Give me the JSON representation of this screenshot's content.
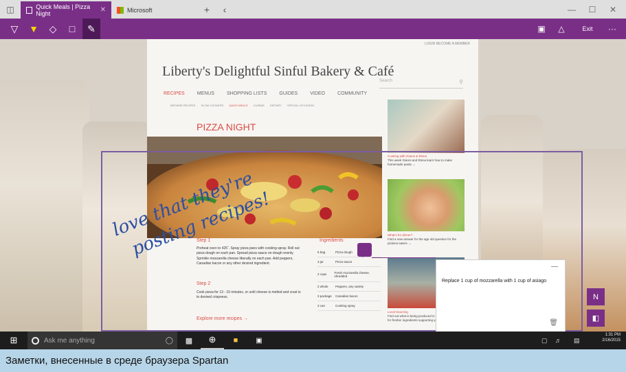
{
  "browser": {
    "tabs": [
      {
        "label": "Quick Meals | Pizza Night",
        "active": true
      },
      {
        "label": "Microsoft",
        "active": false
      }
    ],
    "toolbar": {
      "exit_label": "Exit",
      "more_label": "···"
    }
  },
  "page": {
    "top_links": "LOGIN  BECOME A MEMBER",
    "title": "Liberty's Delightful Sinful Bakery & Café",
    "search_placeholder": "Search",
    "nav": [
      "RECIPES",
      "MENUS",
      "SHOPPING LISTS",
      "GUIDES",
      "VIDEO",
      "COMMUNITY"
    ],
    "subnav": [
      "BROWSE RECIPES",
      "SLOW COOKERS",
      "QUICK MEALS",
      "CUISINE",
      "DIETARY",
      "SPECIAL OCCASION"
    ],
    "heading": "PIZZA NIGHT",
    "step1_title": "Step 1",
    "step1_text": "Preheat oven to 425˚. Spray pizza pans with cooking spray. Roll out pizza dough on each pan. Spread pizza sauce on dough evenly. Sprinkle mozzarella cheese liberally on each pan. Add peppers, Canadian bacon or any other desired ingredient.",
    "step2_title": "Step 2",
    "step2_text": "Cook pizza for 13 - 15 minutes, or until cheese is melted and crust is to desired crispness.",
    "more_link": "Explore more recipes →",
    "ingredients_title": "Ingredients",
    "ingredients": [
      {
        "qty": "5 bag",
        "item": "Pizza dough"
      },
      {
        "qty": "3 jar",
        "item": "Pizza sauce"
      },
      {
        "qty": "2 cups",
        "item": "Fresh mozzarella cheese, shredded"
      },
      {
        "qty": "2 whole",
        "item": "Peppers, any variety"
      },
      {
        "qty": "3 package",
        "item": "Canadian bacon"
      },
      {
        "qty": "3 can",
        "item": "Cooking spray"
      }
    ],
    "side": [
      {
        "title": "Cooking with Gianni & Elena",
        "text": "This week Gianni and Elena learn how to make homemade pasta →"
      },
      {
        "title": "What's for dinner?",
        "text": "Find a new answer for the age old question for the pickiest eaters →"
      },
      {
        "title": "Local Sourcing",
        "text": "Find out what is being produced in your local backyard for fresher ingredients supporting your local farmers"
      }
    ]
  },
  "annotation": {
    "handwriting_line1": "love that they're",
    "handwriting_line2": "posting recipes!",
    "note_text": "Replace 1 cup of mozzarella with 1 cup of asiago",
    "ink_color": "#2a4fa3",
    "accent": "#7a2f87"
  },
  "taskbar": {
    "search_placeholder": "Ask me anything",
    "time": "1:31 PM",
    "date": "2/16/2015"
  },
  "caption": "Заметки, внесенные в среде браузера Spartan"
}
